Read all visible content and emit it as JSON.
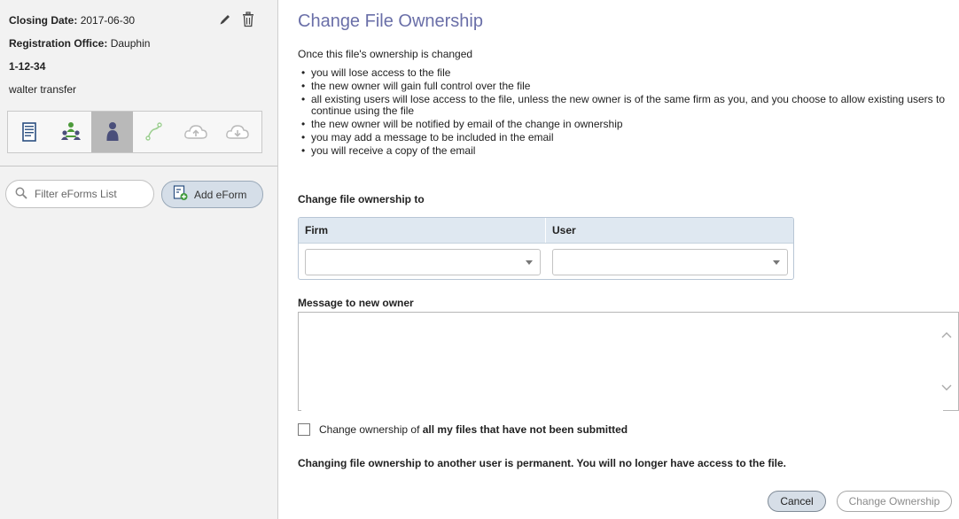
{
  "sidebar": {
    "closing_date_label": "Closing Date:",
    "closing_date_value": "2017-06-30",
    "registration_label": "Registration Office:",
    "registration_value": "Dauphin",
    "file_number": "1-12-34",
    "file_description": "walter transfer",
    "actions": {
      "edit_icon": "pencil-icon",
      "delete_icon": "trash-icon"
    },
    "toolbar": [
      {
        "name": "document",
        "icon": "document-icon",
        "active": false
      },
      {
        "name": "parties",
        "icon": "users-network-icon",
        "active": false
      },
      {
        "name": "ownership",
        "icon": "person-icon",
        "active": true
      },
      {
        "name": "workflow",
        "icon": "route-icon",
        "active": false
      },
      {
        "name": "upload",
        "icon": "cloud-upload-icon",
        "active": false
      },
      {
        "name": "download",
        "icon": "cloud-download-icon",
        "active": false
      }
    ],
    "filter_placeholder": "Filter eForms List",
    "add_eform_label": "Add eForm"
  },
  "main": {
    "title": "Change File Ownership",
    "intro": "Once this file's ownership is changed",
    "bullets": [
      "you will lose access to the file",
      "the new owner will gain full control over the file",
      "all existing users will lose access to the file, unless the new owner is of the same firm as you, and you choose to allow existing users to continue using the file",
      "the new owner will be notified by email of the change in ownership",
      "you may add a message to be included in the email",
      "you will receive a copy of the email"
    ],
    "change_to_label": "Change file ownership to",
    "table": {
      "firm_header": "Firm",
      "user_header": "User",
      "firm_value": "",
      "user_value": ""
    },
    "message_label": "Message to new owner",
    "message_value": "",
    "checkbox_prefix": "Change ownership of ",
    "checkbox_bold": "all my files that have not been submitted",
    "checkbox_checked": false,
    "warning": "Changing file ownership to another user is permanent. You will no longer have access to the file.",
    "cancel_label": "Cancel",
    "change_label": "Change Ownership"
  },
  "colors": {
    "title": "#6a6fa8",
    "button_bg": "#d6dee7",
    "table_header_bg": "#dfe8f1",
    "active_tool_bg": "#b9b9b9"
  }
}
